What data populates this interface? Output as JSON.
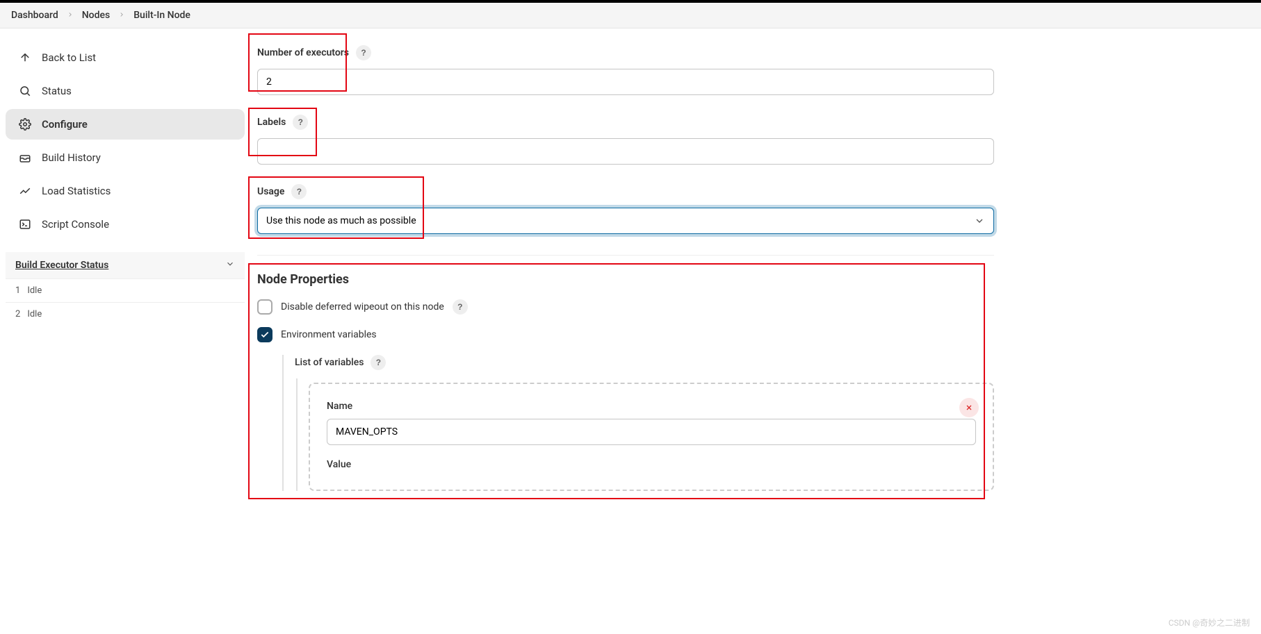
{
  "breadcrumb": {
    "items": [
      "Dashboard",
      "Nodes",
      "Built-In Node"
    ]
  },
  "sidebar": {
    "items": [
      {
        "label": "Back to List",
        "icon": "arrow-up"
      },
      {
        "label": "Status",
        "icon": "search"
      },
      {
        "label": "Configure",
        "icon": "gear",
        "active": true
      },
      {
        "label": "Build History",
        "icon": "tray"
      },
      {
        "label": "Load Statistics",
        "icon": "chart"
      },
      {
        "label": "Script Console",
        "icon": "terminal"
      }
    ]
  },
  "executor_panel": {
    "title": "Build Executor Status",
    "rows": [
      {
        "num": "1",
        "state": "Idle"
      },
      {
        "num": "2",
        "state": "Idle"
      }
    ]
  },
  "form": {
    "executors": {
      "label": "Number of executors",
      "value": "2"
    },
    "labels": {
      "label": "Labels",
      "value": ""
    },
    "usage": {
      "label": "Usage",
      "value": "Use this node as much as possible"
    },
    "node_properties": {
      "title": "Node Properties",
      "disable_wipeout": {
        "label": "Disable deferred wipeout on this node",
        "checked": false
      },
      "env_vars": {
        "label": "Environment variables",
        "checked": true,
        "list_label": "List of variables",
        "items": [
          {
            "name_label": "Name",
            "name_value": "MAVEN_OPTS",
            "value_label": "Value"
          }
        ]
      }
    }
  },
  "watermark": "CSDN @奇妙之二进制"
}
